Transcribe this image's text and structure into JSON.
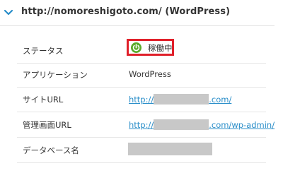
{
  "header": {
    "title": "http://nomoreshigoto.com/ (WordPress)",
    "chevron_icon": "chevron-down-icon"
  },
  "rows": {
    "status": {
      "label": "ステータス",
      "value": "稼働中",
      "icon": "power-icon",
      "icon_color": "#5aaa2a",
      "highlight_color": "#e0202a"
    },
    "application": {
      "label": "アプリケーション",
      "value": "WordPress"
    },
    "site_url": {
      "label": "サイトURL",
      "prefix": "http://",
      "suffix": ".com/"
    },
    "admin_url": {
      "label": "管理画面URL",
      "prefix": "http://",
      "suffix": ".com/wp-admin/"
    },
    "database": {
      "label": "データベース名"
    }
  },
  "colors": {
    "link": "#2a8ec9",
    "redaction": "#c8c8c8"
  }
}
